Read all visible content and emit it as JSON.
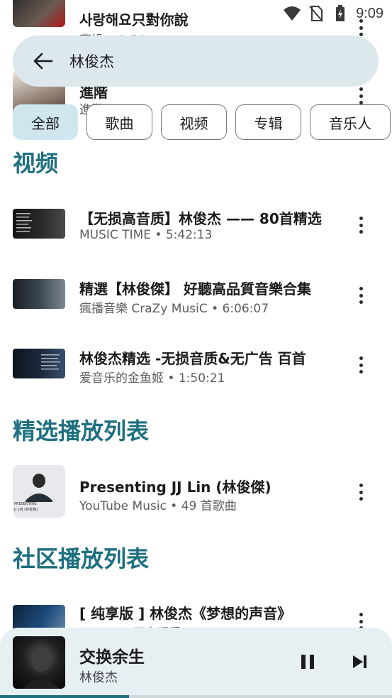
{
  "status_bar": {
    "time": "9:09"
  },
  "background_list": [
    {
      "title": "사랑해요只對你說",
      "subtitle": "曹操 • 3:56"
    },
    {
      "title": "進階",
      "subtitle": "進階 • 3:39"
    }
  ],
  "search": {
    "query": "林俊杰"
  },
  "chips": [
    "全部",
    "歌曲",
    "视频",
    "专辑",
    "音乐人"
  ],
  "sections": {
    "videos": {
      "title": "视频",
      "items": [
        {
          "title": "【无损高音质】林俊杰 —— 80首精选",
          "subtitle": "MUSIC TIME • 5:42:13"
        },
        {
          "title": "精選【林俊傑】 好聽高品質音樂合集",
          "subtitle": "瘋播音樂 CraZy MusiC • 6:06:07"
        },
        {
          "title": "林俊杰精选 -无损音质&无广告 百首",
          "subtitle": "爱音乐的金鱼姬 • 1:50:21"
        }
      ]
    },
    "featured_playlists": {
      "title": "精选播放列表",
      "items": [
        {
          "title": "Presenting JJ Lin (林俊傑)",
          "subtitle": "YouTube Music • 49 首歌曲",
          "thumb_caption": "PRESENTING",
          "thumb_caption2": "JJ LIN (林俊傑)"
        }
      ]
    },
    "community_playlists": {
      "title": "社区播放列表",
      "items": [
        {
          "title": "[ 纯享版 ] 林俊杰《梦想的声音》",
          "subtitle": "Ann • 56万次观看"
        }
      ]
    }
  },
  "player": {
    "title": "交换余生",
    "artist": "林俊杰",
    "progress": 0.33
  },
  "colors": {
    "accent": "#1e6f80",
    "search_bg": "#dde8ec",
    "chip_active": "#cfe6ef",
    "player_bg": "#e6eff2"
  }
}
